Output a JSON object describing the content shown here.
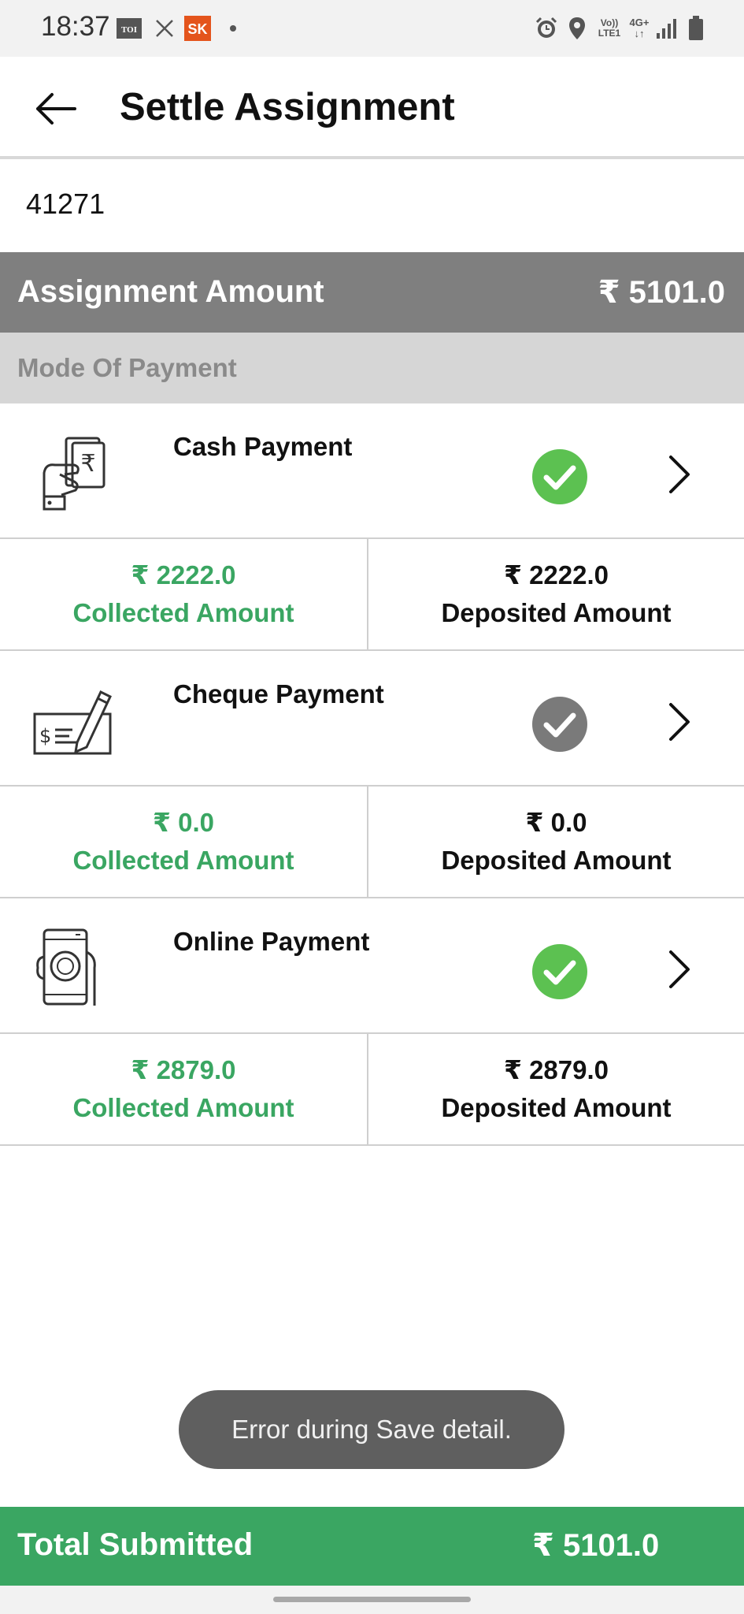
{
  "status_bar": {
    "time": "18:37",
    "left_icons": [
      "toi-app-icon",
      "missed-call-icon",
      "sk-app-icon",
      "notification-dot-icon"
    ],
    "toi_label": "TOI",
    "sk_label": "SK",
    "network_label_top": "Vo))",
    "network_label_bottom": "LTE1",
    "network_type": "4G+",
    "right_icons": [
      "alarm-icon",
      "location-icon",
      "volte-icon",
      "network-4g-icon",
      "signal-icon",
      "battery-icon"
    ]
  },
  "header": {
    "title": "Settle Assignment",
    "back_icon": "arrow-left-icon"
  },
  "assignment": {
    "id": "41271",
    "amount_label": "Assignment Amount",
    "amount_value": "₹ 5101.0"
  },
  "mode_label": "Mode Of Payment",
  "payments": [
    {
      "title": "Cash Payment",
      "icon": "cash-hand-icon",
      "status": "complete",
      "status_color": "#5cc151",
      "collected_value": "₹ 2222.0",
      "collected_label": "Collected Amount",
      "deposited_value": "₹ 2222.0",
      "deposited_label": "Deposited Amount"
    },
    {
      "title": "Cheque Payment",
      "icon": "cheque-pen-icon",
      "status": "pending",
      "status_color": "#7a7a7a",
      "collected_value": "₹ 0.0",
      "collected_label": "Collected Amount",
      "deposited_value": "₹ 0.0",
      "deposited_label": "Deposited Amount"
    },
    {
      "title": "Online Payment",
      "icon": "phone-payment-icon",
      "status": "complete",
      "status_color": "#5cc151",
      "collected_value": "₹ 2879.0",
      "collected_label": "Collected Amount",
      "deposited_value": "₹ 2879.0",
      "deposited_label": "Deposited Amount"
    }
  ],
  "toast": {
    "message": "Error during Save detail."
  },
  "footer": {
    "total_label": "Total Submitted",
    "total_value": "₹ 5101.0"
  },
  "colors": {
    "accent_green": "#3aa662",
    "header_gray": "#7f7f7f",
    "section_gray": "#d6d6d6"
  }
}
